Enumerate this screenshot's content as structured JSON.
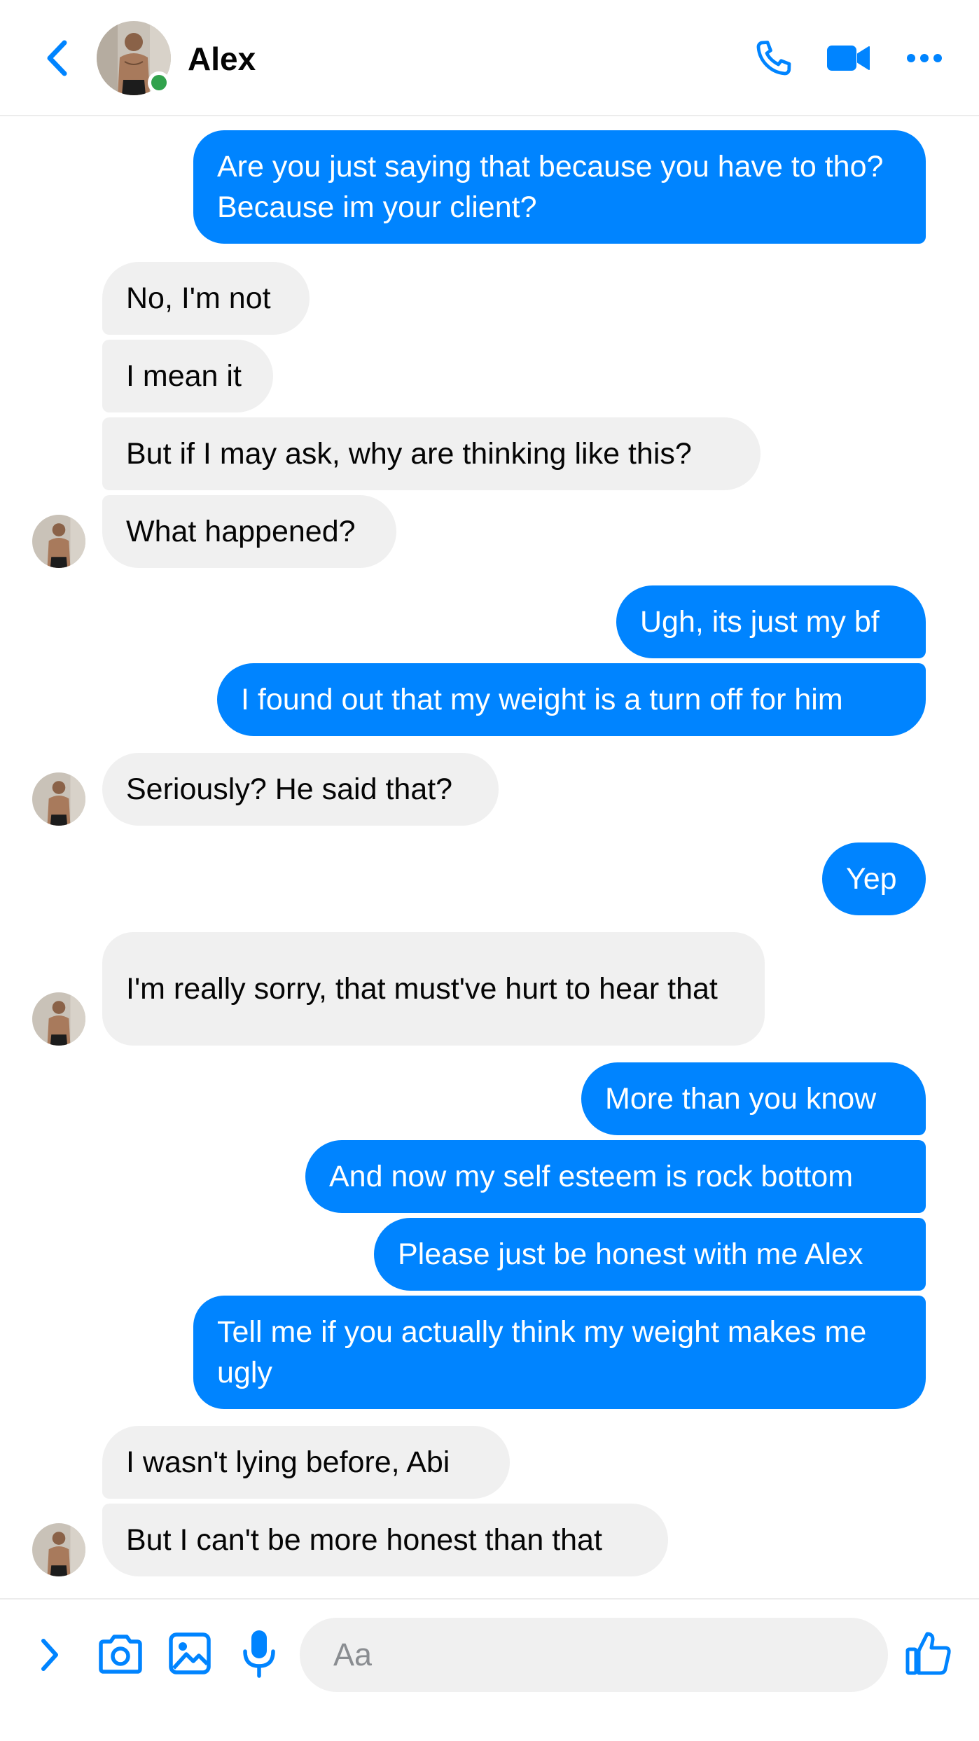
{
  "colors": {
    "accent": "#0084ff",
    "outgoing_bubble": "#0084ff",
    "incoming_bubble": "#f0f0f0",
    "online": "#31a24c"
  },
  "header": {
    "contact_name": "Alex",
    "contact_online": true,
    "icons": [
      "back-arrow-icon",
      "phone-icon",
      "video-camera-icon",
      "more-dots-icon"
    ]
  },
  "messages": [
    {
      "from": "me",
      "text": "Are you just saying that because you have to tho? Because im your client?"
    },
    {
      "from": "alex",
      "text": "No, I'm not"
    },
    {
      "from": "alex",
      "text": "I mean it"
    },
    {
      "from": "alex",
      "text": "But if I may ask, why are thinking like this?"
    },
    {
      "from": "alex",
      "text": "What happened?"
    },
    {
      "from": "me",
      "text": "Ugh, its just my bf"
    },
    {
      "from": "me",
      "text": "I found out that my weight is a turn off for him"
    },
    {
      "from": "alex",
      "text": "Seriously? He said that?"
    },
    {
      "from": "me",
      "text": "Yep"
    },
    {
      "from": "alex",
      "text": "I'm really sorry, that must've hurt to hear that"
    },
    {
      "from": "me",
      "text": "More than you know"
    },
    {
      "from": "me",
      "text": "And now my self esteem is rock bottom"
    },
    {
      "from": "me",
      "text": "Please just be honest with me Alex"
    },
    {
      "from": "me",
      "text": "Tell me if you actually think my weight makes me ugly"
    },
    {
      "from": "alex",
      "text": "I wasn't lying before, Abi"
    },
    {
      "from": "alex",
      "text": "But I can't be more honest than that"
    }
  ],
  "composer": {
    "placeholder": "Aa",
    "value": "",
    "icons": [
      "expand-chevron-icon",
      "camera-icon",
      "image-icon",
      "microphone-icon",
      "thumbs-up-icon"
    ]
  }
}
